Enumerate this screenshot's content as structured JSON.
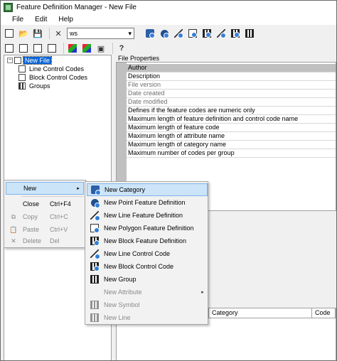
{
  "window": {
    "title": "Feature Definition Manager - New File"
  },
  "menubar": {
    "items": [
      "File",
      "Edit",
      "Help"
    ]
  },
  "toolbar": {
    "combo_value": "ws"
  },
  "tree": {
    "root": "New File",
    "children": [
      "Line Control Codes",
      "Block Control Codes",
      "Groups"
    ]
  },
  "file_properties": {
    "title": "File Properties",
    "rows": [
      "Author",
      "Description",
      "File version",
      "Date created",
      "Date modified",
      "Defines if the feature codes are numeric only",
      "Maximum length of feature definition and control code name",
      "Maximum length of feature code",
      "Maximum length of attribute name",
      "Maximum length of category name",
      "Maximum number of codes per group"
    ]
  },
  "lower_grid": {
    "col_category": "Category",
    "col_code": "Code"
  },
  "context_menu": {
    "items": [
      {
        "label": "New",
        "shortcut": "",
        "arrow": "▸"
      },
      {
        "label": "Close",
        "shortcut": "Ctrl+F4"
      },
      {
        "label": "Copy",
        "shortcut": "Ctrl+C"
      },
      {
        "label": "Paste",
        "shortcut": "Ctrl+V"
      },
      {
        "label": "Delete",
        "shortcut": "Del"
      }
    ]
  },
  "submenu": {
    "items": [
      "New Category",
      "New Point Feature Definition",
      "New Line Feature Definition",
      "New Polygon Feature Definition",
      "New Block Feature Definition",
      "New Line Control Code",
      "New Block Control Code",
      "New Group",
      "New Attribute",
      "New Symbol",
      "New Line"
    ],
    "arrow": "▸"
  },
  "colors": {
    "selection": "#0a64d6",
    "menu_highlight": "#cce4f7"
  }
}
